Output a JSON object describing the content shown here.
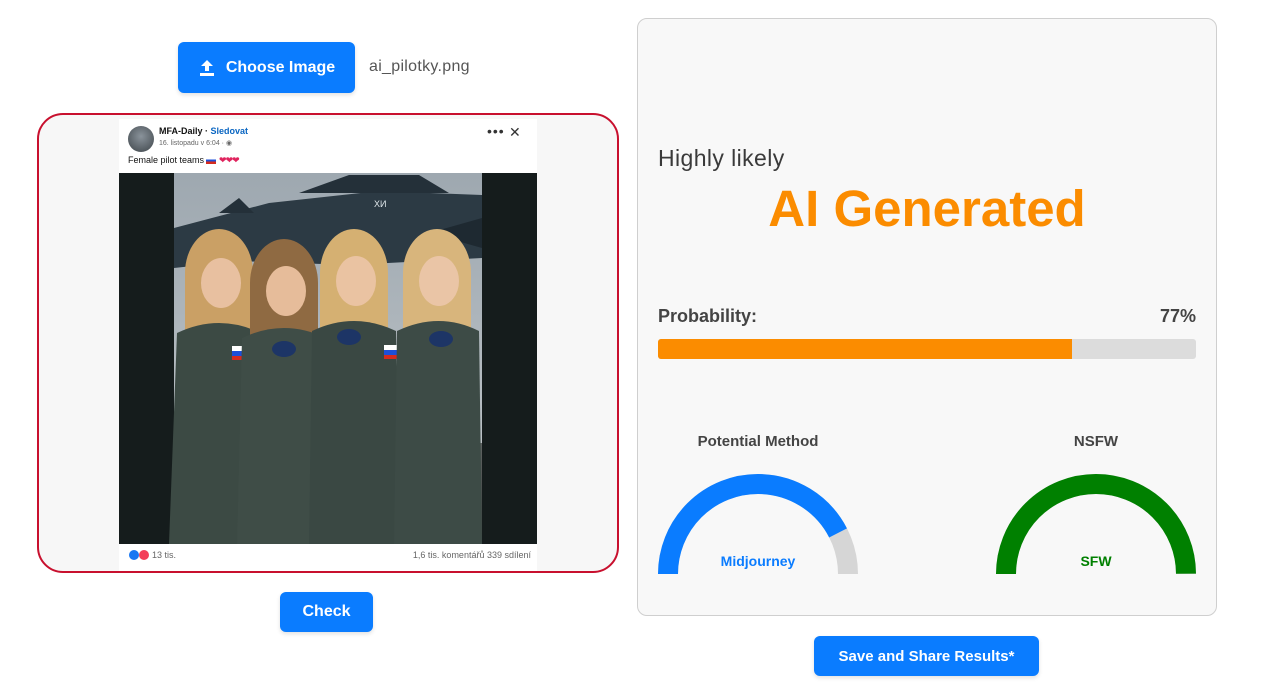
{
  "upload": {
    "choose_label": "Choose Image",
    "file_name": "ai_pilotky.png"
  },
  "post": {
    "author": "MFA-Daily",
    "follow": "Sledovat",
    "date": "16. listopadu v 6:04 · ",
    "caption": "Female pilot teams",
    "hearts": "❤❤❤",
    "reactions_count": "13 tis.",
    "stats": "1,6 tis. komentářů   339 sdílení"
  },
  "actions": {
    "check_label": "Check",
    "share_label": "Save and Share Results*"
  },
  "result": {
    "likelihood": "Highly likely",
    "verdict": "AI Generated",
    "probability_label": "Probability:",
    "probability_text": "77%",
    "probability_value": 0.77,
    "method_title": "Potential Method",
    "method_value": "Midjourney",
    "method_gauge_value": 0.85,
    "nsfw_title": "NSFW",
    "nsfw_value": "SFW",
    "nsfw_gauge_value": 1.0
  },
  "colors": {
    "accent_blue": "#0a7cff",
    "ai_orange": "#fb8c00",
    "sfw_green": "#008000",
    "frame_red": "#c8102e"
  }
}
